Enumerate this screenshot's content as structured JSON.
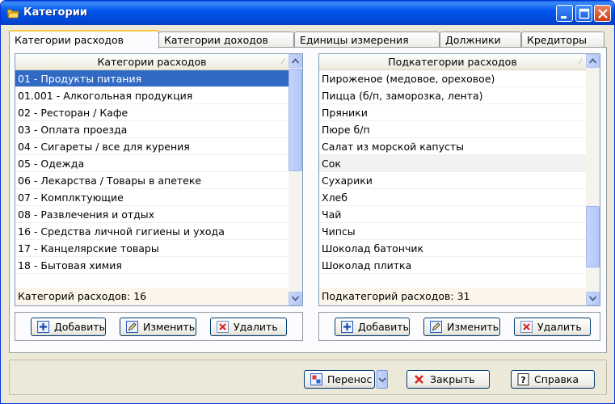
{
  "window": {
    "title": "Категории"
  },
  "tabs": [
    {
      "label": "Категории расходов"
    },
    {
      "label": "Категории доходов"
    },
    {
      "label": "Единицы измерения"
    },
    {
      "label": "Должники"
    },
    {
      "label": "Кредиторы"
    }
  ],
  "left": {
    "header": "Категории расходов",
    "rows": [
      "01 - Продукты питания",
      "01.001 - Алкогольная продукция",
      "02 - Ресторан / Кафе",
      "03 - Оплата проезда",
      "04 - Сигареты / все для курения",
      "05 - Одежда",
      "06 - Лекарства / Товары в апетеке",
      "07 - Комплктующие",
      "08 - Развлечения и отдых",
      "16 - Средства личной гигиены и ухода",
      "17 - Канцелярские товары",
      "18 - Бытовая химия"
    ],
    "selected_index": 0,
    "footer": "Категорий расходов: 16",
    "buttons": {
      "add": "Добавить",
      "edit": "Изменить",
      "delete": "Удалить"
    }
  },
  "right": {
    "header": "Подкатегории расходов",
    "rows": [
      "Пироженое (медовое, ореховое)",
      "Пицца (б/п, заморозка, лента)",
      "Пряники",
      "Пюре б/п",
      "Салат из морской капусты",
      "Сок",
      "Сухарики",
      "Хлеб",
      "Чай",
      "Чипсы",
      "Шоколад батончик",
      "Шоколад плитка"
    ],
    "highlighted_index": 5,
    "footer": "Подкатегорий расходов: 31",
    "buttons": {
      "add": "Добавить",
      "edit": "Изменить",
      "delete": "Удалить"
    }
  },
  "bottom": {
    "transfer": "Перенос",
    "close": "Закрыть",
    "help": "Справка"
  },
  "colors": {
    "selection": "#316AC5",
    "titlebar": "#0058EE",
    "active_tab_accent": "#FFC83C"
  }
}
